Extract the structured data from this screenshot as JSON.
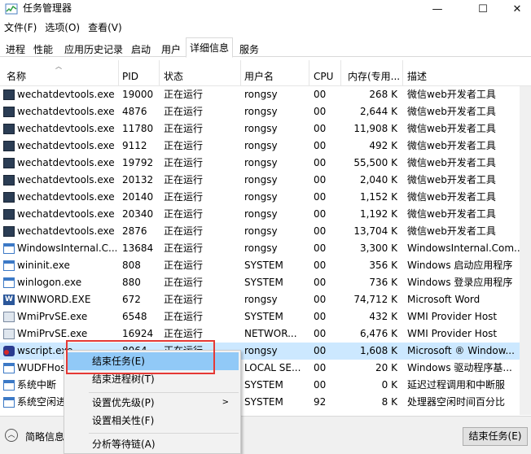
{
  "window": {
    "title": "任务管理器",
    "minimize_glyph": "—",
    "maximize_glyph": "☐",
    "close_glyph": "✕"
  },
  "menu": [
    "文件(F)",
    "选项(O)",
    "查看(V)"
  ],
  "tabs": [
    "进程",
    "性能",
    "应用历史记录",
    "启动",
    "用户",
    "详细信息",
    "服务"
  ],
  "active_tab": "详细信息",
  "columns": {
    "name": "名称",
    "pid": "PID",
    "status": "状态",
    "user": "用户名",
    "cpu": "CPU",
    "memory": "内存(专用...",
    "desc": "描述"
  },
  "rows": [
    {
      "name": "wechatdevtools.exe",
      "pid": "19000",
      "status": "正在运行",
      "user": "rongsy",
      "cpu": "00",
      "mem": "268 K",
      "desc": "微信web开发者工具",
      "icon": "devtools-icon"
    },
    {
      "name": "wechatdevtools.exe",
      "pid": "4876",
      "status": "正在运行",
      "user": "rongsy",
      "cpu": "00",
      "mem": "2,644 K",
      "desc": "微信web开发者工具",
      "icon": "devtools-icon"
    },
    {
      "name": "wechatdevtools.exe",
      "pid": "11780",
      "status": "正在运行",
      "user": "rongsy",
      "cpu": "00",
      "mem": "11,908 K",
      "desc": "微信web开发者工具",
      "icon": "devtools-icon"
    },
    {
      "name": "wechatdevtools.exe",
      "pid": "9112",
      "status": "正在运行",
      "user": "rongsy",
      "cpu": "00",
      "mem": "492 K",
      "desc": "微信web开发者工具",
      "icon": "devtools-icon"
    },
    {
      "name": "wechatdevtools.exe",
      "pid": "19792",
      "status": "正在运行",
      "user": "rongsy",
      "cpu": "00",
      "mem": "55,500 K",
      "desc": "微信web开发者工具",
      "icon": "devtools-icon"
    },
    {
      "name": "wechatdevtools.exe",
      "pid": "20132",
      "status": "正在运行",
      "user": "rongsy",
      "cpu": "00",
      "mem": "2,040 K",
      "desc": "微信web开发者工具",
      "icon": "devtools-icon"
    },
    {
      "name": "wechatdevtools.exe",
      "pid": "20140",
      "status": "正在运行",
      "user": "rongsy",
      "cpu": "00",
      "mem": "1,152 K",
      "desc": "微信web开发者工具",
      "icon": "devtools-icon"
    },
    {
      "name": "wechatdevtools.exe",
      "pid": "20340",
      "status": "正在运行",
      "user": "rongsy",
      "cpu": "00",
      "mem": "1,192 K",
      "desc": "微信web开发者工具",
      "icon": "devtools-icon"
    },
    {
      "name": "wechatdevtools.exe",
      "pid": "2876",
      "status": "正在运行",
      "user": "rongsy",
      "cpu": "00",
      "mem": "13,704 K",
      "desc": "微信web开发者工具",
      "icon": "devtools-icon"
    },
    {
      "name": "WindowsInternal.C...",
      "pid": "13684",
      "status": "正在运行",
      "user": "rongsy",
      "cpu": "00",
      "mem": "3,300 K",
      "desc": "WindowsInternal.Com...",
      "icon": "window-icon"
    },
    {
      "name": "wininit.exe",
      "pid": "808",
      "status": "正在运行",
      "user": "SYSTEM",
      "cpu": "00",
      "mem": "356 K",
      "desc": "Windows 启动应用程序",
      "icon": "window-icon"
    },
    {
      "name": "winlogon.exe",
      "pid": "880",
      "status": "正在运行",
      "user": "SYSTEM",
      "cpu": "00",
      "mem": "736 K",
      "desc": "Windows 登录应用程序",
      "icon": "window-icon"
    },
    {
      "name": "WINWORD.EXE",
      "pid": "672",
      "status": "正在运行",
      "user": "rongsy",
      "cpu": "00",
      "mem": "74,712 K",
      "desc": "Microsoft Word",
      "icon": "word-icon"
    },
    {
      "name": "WmiPrvSE.exe",
      "pid": "6548",
      "status": "正在运行",
      "user": "SYSTEM",
      "cpu": "00",
      "mem": "432 K",
      "desc": "WMI Provider Host",
      "icon": "gear-icon"
    },
    {
      "name": "WmiPrvSE.exe",
      "pid": "16924",
      "status": "正在运行",
      "user": "NETWOR...",
      "cpu": "00",
      "mem": "6,476 K",
      "desc": "WMI Provider Host",
      "icon": "gear-icon"
    },
    {
      "name": "wscript.exe",
      "pid": "8064",
      "status": "正在运行",
      "user": "rongsy",
      "cpu": "00",
      "mem": "1,608 K",
      "desc": "Microsoft ® Window...",
      "icon": "script-icon",
      "selected": true
    },
    {
      "name": "WUDFHost.exe",
      "pid": "",
      "status": "",
      "user": "LOCAL SE...",
      "cpu": "00",
      "mem": "20 K",
      "desc": "Windows 驱动程序基...",
      "icon": "window-icon"
    },
    {
      "name": "系统中断",
      "pid": "",
      "status": "",
      "user": "SYSTEM",
      "cpu": "00",
      "mem": "0 K",
      "desc": "延迟过程调用和中断服",
      "icon": "window-icon"
    },
    {
      "name": "系统空闲进程",
      "pid": "",
      "status": "",
      "user": "SYSTEM",
      "cpu": "92",
      "mem": "8 K",
      "desc": "处理器空闲时间百分比",
      "icon": "window-icon"
    }
  ],
  "context_menu": [
    "结束任务(E)",
    "结束进程树(T)",
    "设置优先级(P)",
    "设置相关性(F)",
    "分析等待链(A)"
  ],
  "submenu_arrow": ">",
  "footer": {
    "fewer_details": "简略信息",
    "fewer_glyph": "︿",
    "end_task": "结束任务(E)"
  },
  "colors": {
    "selection": "#cce8ff",
    "menu_highlight": "#91c9f7",
    "annotation_box": "#e53935"
  }
}
